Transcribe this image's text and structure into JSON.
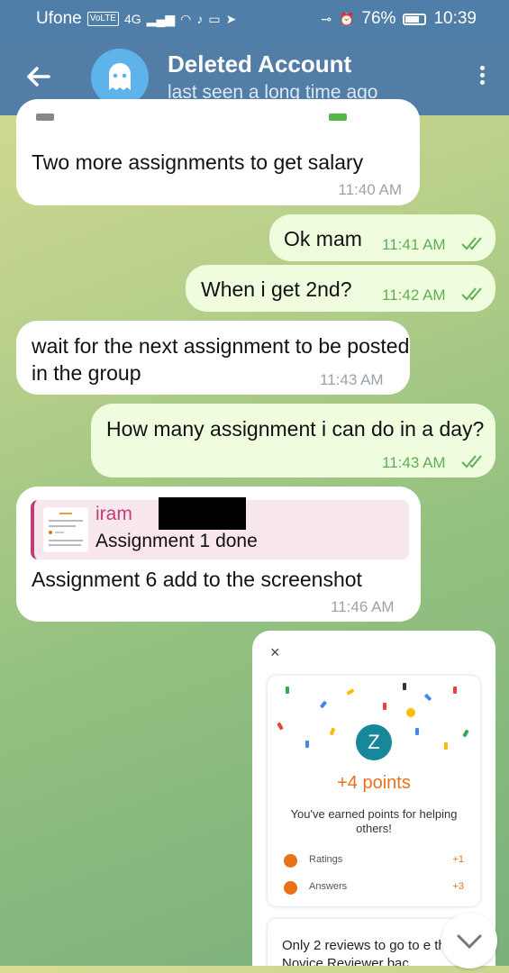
{
  "status_bar": {
    "carrier": "Ufone",
    "volte": "VoLTE",
    "network": "4G",
    "battery": "76%",
    "battery_level": 0.76,
    "time": "10:39"
  },
  "header": {
    "title": "Deleted Account",
    "subtitle": "last seen a long time ago",
    "icons": [
      "back-arrow-icon",
      "ghost-avatar-icon",
      "more-vert-icon"
    ]
  },
  "messages": [
    {
      "dir": "in",
      "text": "Two more assignments to get salary",
      "time": "11:40 AM"
    },
    {
      "dir": "out",
      "text": "Ok mam",
      "time": "11:41 AM",
      "status": "read"
    },
    {
      "dir": "out",
      "text": "When i get 2nd?",
      "time": "11:42 AM",
      "status": "read"
    },
    {
      "dir": "in",
      "text": "wait for the next assignment to be posted in the group",
      "time": "11:43 AM"
    },
    {
      "dir": "out",
      "text": "How many assignment i can do in a day?",
      "time": "11:43 AM",
      "status": "read"
    },
    {
      "dir": "in",
      "text": "Assignment 6 add to the screenshot",
      "time": "11:46 AM",
      "reply": {
        "name": "iram",
        "text": "Assignment 1 done"
      }
    }
  ],
  "screenshot_msg": {
    "close": "×",
    "avatar_letter": "Z",
    "points": "+4 points",
    "earned_text": "You've earned points for helping others!",
    "rows": [
      {
        "label": "Ratings",
        "value": "+1"
      },
      {
        "label": "Answers",
        "value": "+3"
      }
    ],
    "progress_text": "Only 2 reviews to go to e the Novice Reviewer bac"
  },
  "colors": {
    "header": "#517da6",
    "status_bar": "#4f7fa8",
    "incoming": "#ffffff",
    "outgoing": "#effdde",
    "accent_green": "#5fae55",
    "reply_accent": "#c13d76",
    "points_orange": "#e8711a"
  }
}
